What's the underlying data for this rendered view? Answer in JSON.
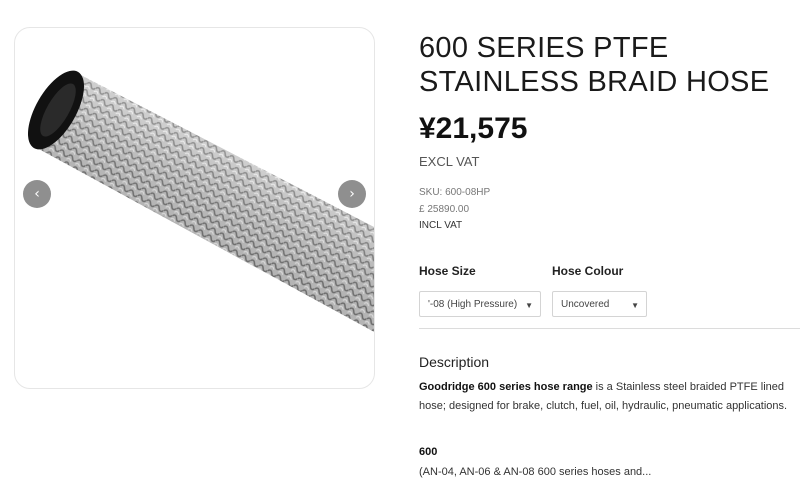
{
  "gallery": {
    "prev_icon": "‹",
    "next_icon": "›",
    "image_alt": "600 series PTFE stainless braid hose"
  },
  "product": {
    "title_line1": "600 SERIES PTFE",
    "title_line2": "STAINLESS BRAID HOSE",
    "price": "¥21,575",
    "price_note": "EXCL VAT",
    "sku": "SKU: 600-08HP",
    "gbp_price": "£ 25890.00",
    "gbp_note": "INCL VAT"
  },
  "options": {
    "hose_size_label": "Hose Size",
    "hose_size_value": "'-08 (High Pressure)",
    "hose_colour_label": "Hose Colour",
    "hose_colour_value": "Uncovered"
  },
  "description": {
    "heading": "Description",
    "lead_bold": "Goodridge 600 series hose range",
    "lead_rest": " is a Stainless steel braided PTFE lined hose; designed for brake, clutch, fuel, oil, hydraulic, pneumatic applications.",
    "sub_heading": "600",
    "sub_text": "(AN-04, AN-06 & AN-08 600 series hoses and..."
  },
  "colors": {
    "accent": "#8f8f8f",
    "border": "#e6e6e6"
  }
}
